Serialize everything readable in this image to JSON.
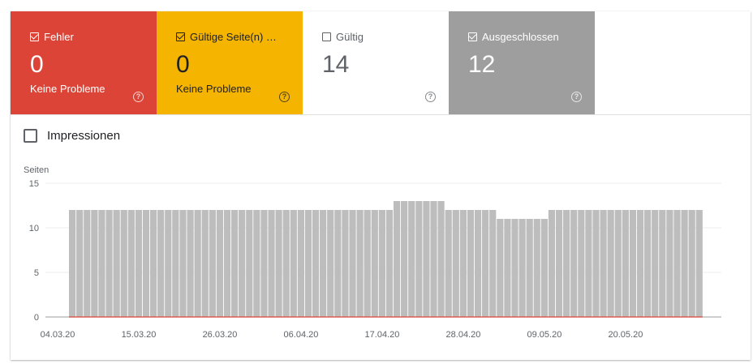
{
  "tiles": [
    {
      "label": "Fehler",
      "value": "0",
      "sub": "Keine Probleme",
      "checked": true
    },
    {
      "label": "Gültige Seite(n) …",
      "value": "0",
      "sub": "Keine Probleme",
      "checked": true
    },
    {
      "label": "Gültig",
      "value": "14",
      "sub": "",
      "checked": false
    },
    {
      "label": "Ausgeschlossen",
      "value": "12",
      "sub": "",
      "checked": true
    }
  ],
  "help_glyph": "?",
  "impressions": {
    "label": "Impressionen",
    "checked": false
  },
  "colors": {
    "error": "#db4437",
    "valid_warning": "#f4b400",
    "valid": "#ffffff",
    "excluded": "#9e9e9e",
    "bar": "#bdbdbd",
    "error_line": "#db4437"
  },
  "chart_data": {
    "type": "bar",
    "ylabel": "Seiten",
    "ylim": [
      0,
      15
    ],
    "yticks": [
      0,
      5,
      10,
      15
    ],
    "x_tick_labels": [
      "04.03.20",
      "15.03.20",
      "26.03.20",
      "06.04.20",
      "17.04.20",
      "28.04.20",
      "09.05.20",
      "20.05.20"
    ],
    "x_tick_indices": [
      0,
      11,
      22,
      33,
      44,
      55,
      66,
      77
    ],
    "dates_start": "04.03.20",
    "series": [
      {
        "name": "Ausgeschlossen",
        "values": [
          12,
          12,
          12,
          12,
          12,
          12,
          12,
          12,
          12,
          12,
          12,
          12,
          12,
          12,
          12,
          12,
          12,
          12,
          12,
          12,
          12,
          12,
          12,
          12,
          12,
          12,
          12,
          12,
          12,
          12,
          12,
          12,
          12,
          12,
          12,
          12,
          12,
          12,
          12,
          12,
          12,
          12,
          12,
          12,
          13,
          13,
          13,
          13,
          13,
          13,
          13,
          12,
          12,
          12,
          12,
          12,
          12,
          12,
          11,
          11,
          11,
          11,
          11,
          11,
          11,
          12,
          12,
          12,
          12,
          12,
          12,
          12,
          12,
          12,
          12,
          12,
          12,
          12,
          12,
          12,
          12,
          12,
          12,
          12,
          12,
          12
        ]
      },
      {
        "name": "Fehler",
        "values": [
          0,
          0,
          0,
          0,
          0,
          0,
          0,
          0,
          0,
          0,
          0,
          0,
          0,
          0,
          0,
          0,
          0,
          0,
          0,
          0,
          0,
          0,
          0,
          0,
          0,
          0,
          0,
          0,
          0,
          0,
          0,
          0,
          0,
          0,
          0,
          0,
          0,
          0,
          0,
          0,
          0,
          0,
          0,
          0,
          0,
          0,
          0,
          0,
          0,
          0,
          0,
          0,
          0,
          0,
          0,
          0,
          0,
          0,
          0,
          0,
          0,
          0,
          0,
          0,
          0,
          0,
          0,
          0,
          0,
          0,
          0,
          0,
          0,
          0,
          0,
          0,
          0,
          0,
          0,
          0,
          0,
          0,
          0,
          0,
          0,
          0
        ]
      }
    ]
  }
}
